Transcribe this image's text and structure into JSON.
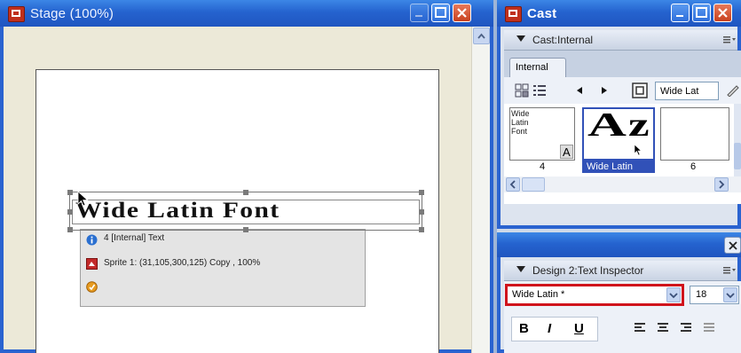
{
  "stage": {
    "title": "Stage (100%)",
    "text_sprite": "Wide Latin Font",
    "info": [
      {
        "icon": "info-icon",
        "text": "4 [Internal] Text"
      },
      {
        "icon": "sprite-icon",
        "text": "Sprite 1: (31,105,300,125) Copy , 100%"
      },
      {
        "icon": "behavior-icon",
        "text": ""
      }
    ]
  },
  "cast": {
    "title": "Cast",
    "header": "Cast:Internal",
    "tab": "Internal",
    "member_name_field": "Wide Lat",
    "thumbs": [
      {
        "caption": "Wide Latin Font",
        "number": "4",
        "glyph": "A",
        "selected": false
      },
      {
        "caption": "",
        "number": "Wide Latin",
        "glyph": "A",
        "selected": true
      },
      {
        "caption": "",
        "number": "6",
        "glyph": "",
        "selected": false
      }
    ]
  },
  "inspector": {
    "header": "Design 2:Text Inspector",
    "font_value": "Wide Latin *",
    "size_value": "18",
    "bold_label": "B",
    "italic_label": "I",
    "underline_label": "U"
  },
  "colors": {
    "title_blue": "#2563cf",
    "highlight_red": "#d0141c",
    "selection_blue": "#3151b8"
  }
}
